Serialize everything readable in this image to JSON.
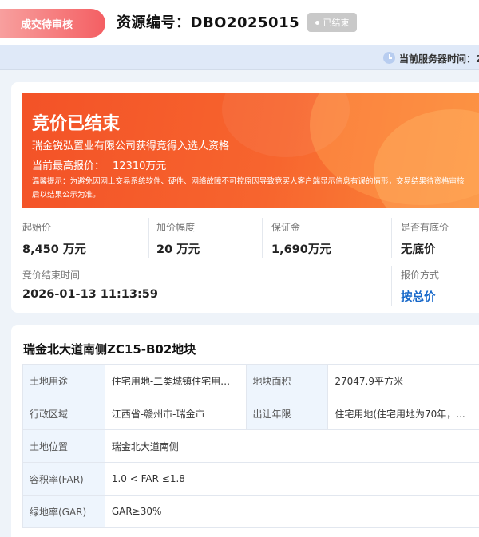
{
  "header": {
    "status": "成交待审核",
    "resource_id": "资源编号：DBO2025015",
    "badge": "已结束"
  },
  "server_time": {
    "label": "当前服务器时间：2"
  },
  "banner": {
    "title": "竞价已结束",
    "winner": "瑞金锐弘置业有限公司获得竞得入选人资格",
    "highest_label": "当前最高报价：",
    "highest_value": "12310万元",
    "tip": "温馨提示：为避免因网上交易系统软件、硬件、网络故障不可控原因导致竞买人客户端显示信息有误的情形，交易结果待资格审核后以结果公示为准。"
  },
  "auction": {
    "start_price_label": "起始价",
    "start_price": "8,450 万元",
    "increment_label": "加价幅度",
    "increment": "20 万元",
    "deposit_label": "保证金",
    "deposit": "1,690万元",
    "reserve_label": "是否有底价",
    "reserve": "无底价",
    "end_time_label": "竞价结束时间",
    "end_time": "2026-01-13 11:13:59",
    "quote_method_label": "报价方式",
    "quote_method": "按总价"
  },
  "plot": {
    "title": "瑞金北大道南侧ZC15-B02地块",
    "rows": [
      {
        "label": "土地用途",
        "value": "住宅用地-二类城镇住宅用地...",
        "label2": "地块面积",
        "value2": "27047.9平方米"
      },
      {
        "label": "行政区域",
        "value": "江西省-赣州市-瑞金市",
        "label2": "出让年限",
        "value2": "住宅用地(住宅用地为70年，..."
      },
      {
        "label": "土地位置",
        "value": "瑞金北大道南侧"
      },
      {
        "label": "容积率(FAR)",
        "value": "1.0 < FAR ≤1.8"
      },
      {
        "label": "绿地率(GAR)",
        "value": "GAR≥30%"
      }
    ]
  },
  "colors": {
    "accent_blue": "#1768c9",
    "banner_orange": "#f35227",
    "status_red": "#f45f63"
  }
}
